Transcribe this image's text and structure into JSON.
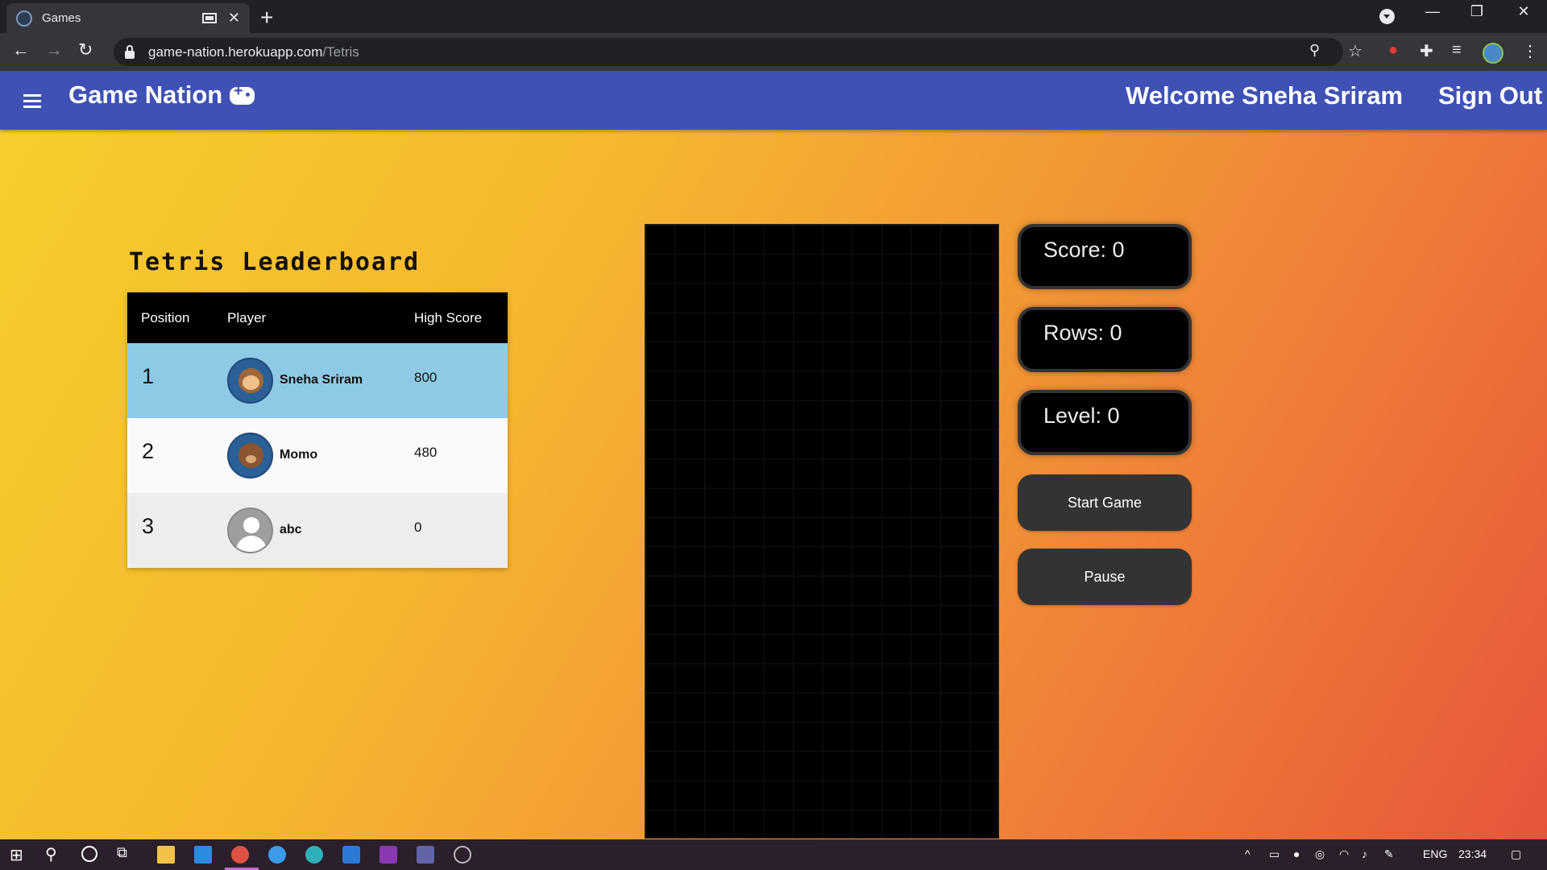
{
  "browser": {
    "tab_title": "Games",
    "url_host": "game-nation.herokuapp.com",
    "url_path": "/Tetris"
  },
  "app": {
    "brand": "Game Nation",
    "welcome": "Welcome Sneha Sriram",
    "sign_out": "Sign Out"
  },
  "leaderboard": {
    "title": "Tetris Leaderboard",
    "headers": {
      "position": "Position",
      "player": "Player",
      "score": "High Score"
    },
    "rows": [
      {
        "position": "1",
        "player": "Sneha Sriram",
        "score": "800",
        "avatar": "monkey-icon"
      },
      {
        "position": "2",
        "player": "Momo",
        "score": "480",
        "avatar": "bear-icon"
      },
      {
        "position": "3",
        "player": "abc",
        "score": "0",
        "avatar": "default-user-icon"
      }
    ]
  },
  "game": {
    "score": "Score: 0",
    "rows": "Rows: 0",
    "level": "Level: 0",
    "start": "Start Game",
    "pause": "Pause"
  },
  "taskbar": {
    "lang": "ENG",
    "time": "23:34"
  },
  "colors": {
    "appbar": "#3f51b5",
    "leader_row_highlight": "#8ecae6",
    "button": "#333333"
  }
}
